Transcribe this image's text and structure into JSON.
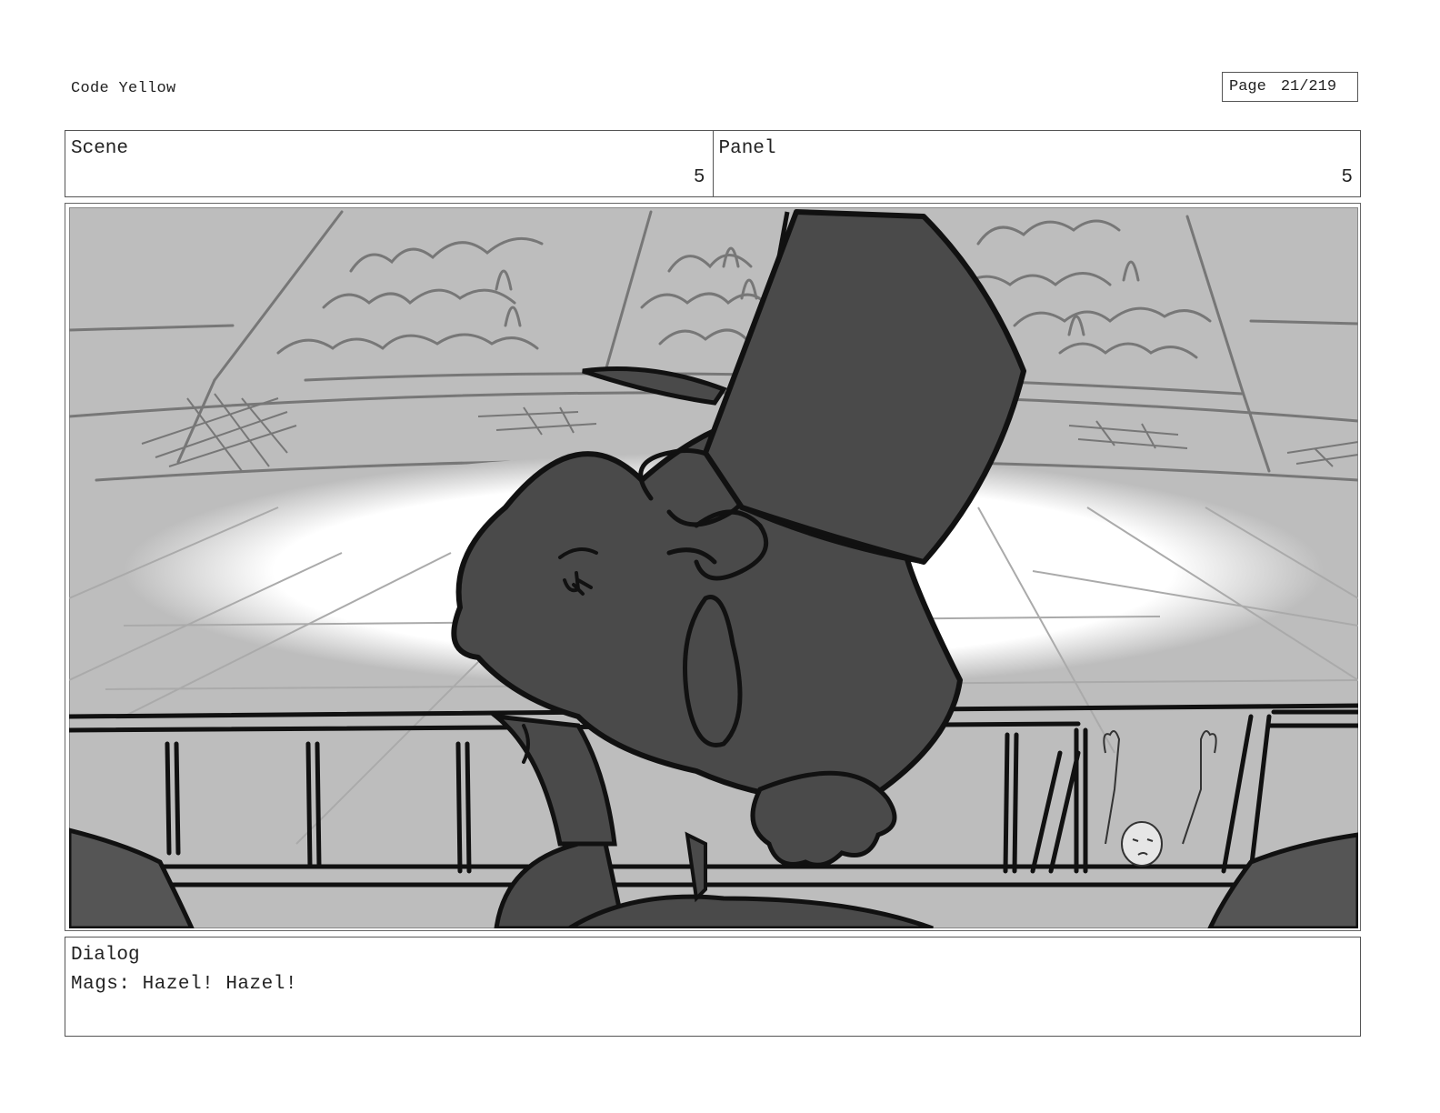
{
  "header": {
    "project_title": "Code Yellow",
    "page_label": "Page",
    "page_value": "21/219"
  },
  "info": {
    "scene_label": "Scene",
    "scene_value": "5",
    "panel_label": "Panel",
    "panel_value": "5"
  },
  "dialog": {
    "label": "Dialog",
    "text": "Mags: Hazel! Hazel!"
  },
  "colors": {
    "background_gray": "#bdbdbd",
    "character_fill": "#4a4a4a",
    "line": "#111111",
    "sketch_line": "#777777"
  }
}
